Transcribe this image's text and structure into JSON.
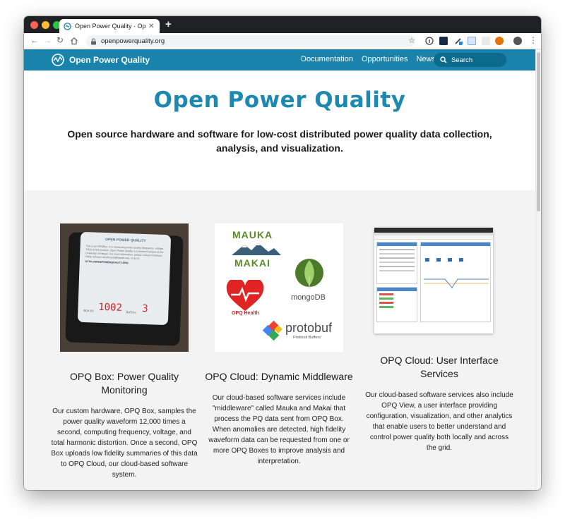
{
  "browser": {
    "tab_title": "Open Power Quality · Open sour",
    "new_tab_icon": "+",
    "url": "openpowerquality.org"
  },
  "site": {
    "brand": "Open Power Quality",
    "nav": [
      "Documentation",
      "Opportunities",
      "News"
    ],
    "search_placeholder": "Search",
    "accent": "#1a83ab"
  },
  "hero": {
    "title": "Open Power Quality",
    "subtitle": "Open source hardware and software for low-cost distributed power quality data collection, analysis, and visualization."
  },
  "features": [
    {
      "title": "OPQ Box: Power Quality Monitoring",
      "body": "Our custom hardware, OPQ Box, samples the power quality waveform 12,000 times a second, computing frequency, voltage, and total harmonic distortion. Once a second, OPQ Box uploads low fidelity summaries of this data to OPQ Cloud, our cloud-based software system.",
      "image": {
        "label_title": "OPEN POWER QUALITY",
        "label_text": "This is an OPQBox. It is measuring power quality (frequency, voltage, THD) at this location. Open Power Quality is a research project at the University of Hawaii. For more information, please contact Professor Philip Johnson at johnson@hawaii.edu, or go to:",
        "label_url": "HTTP://OPENPOWERQUALITY.ORG",
        "box_id": "1002",
        "batch": "3",
        "box_prefix": "BOX ID:",
        "batch_prefix": "BATCH:"
      }
    },
    {
      "title": "OPQ Cloud: Dynamic Middleware",
      "body": "Our cloud-based software services include \"middleware\" called Mauka and Makai that process the PQ data sent from OPQ Box. When anomalies are detected, high fidelity waveform data can be requested from one or more OPQ Boxes to improve analysis and interpretation.",
      "logos": {
        "mauka": "MAUKA",
        "makai": "MAKAI",
        "mongodb": "mongoDB",
        "opq_health": "OPQ Health",
        "protobuf": "protobuf",
        "protobuf_sub": "Protocol Buffers"
      }
    },
    {
      "title": "OPQ Cloud: User Interface Services",
      "body": "Our cloud-based software services also include OPQ View, a user interface providing configuration, visualization, and other analytics that enable users to better understand and control power quality both locally and across the grid."
    }
  ]
}
